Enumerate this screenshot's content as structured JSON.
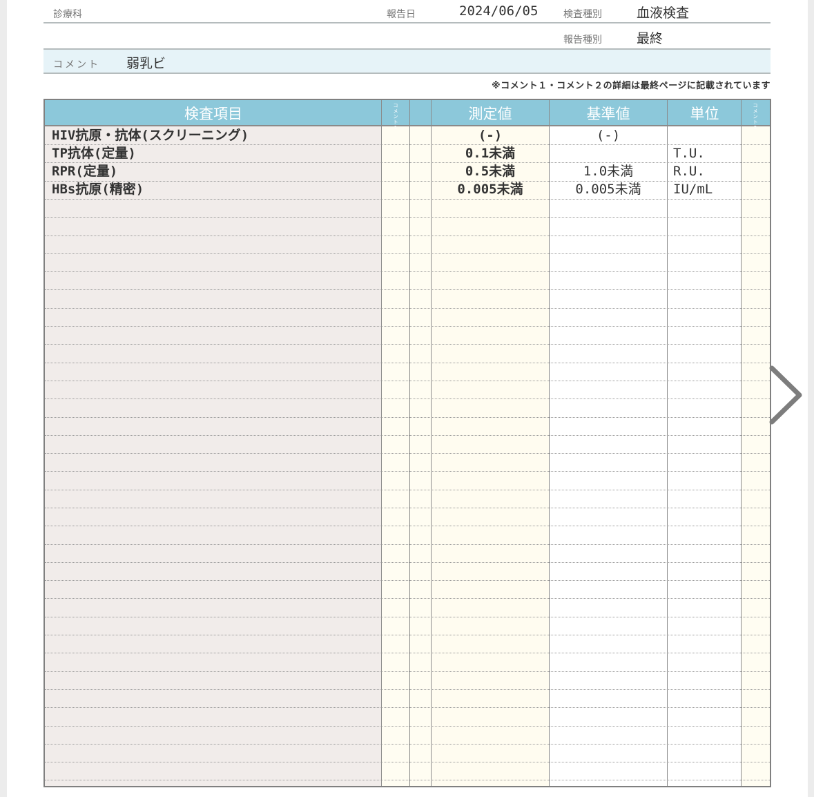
{
  "header": {
    "dept_label": "診療科",
    "report_date_label": "報告日",
    "report_date": "2024/06/05",
    "exam_type_label": "検査種別",
    "exam_type": "血液検査",
    "report_type_label": "報告種別",
    "report_type": "最終"
  },
  "comment": {
    "label": "コメント",
    "text": "弱乳ビ"
  },
  "note": "※コメント１・コメント２の詳細は最終ページに記載されています",
  "table": {
    "headers": {
      "item": "検査項目",
      "comment1": "コメント1",
      "value": "測定値",
      "reference": "基準値",
      "unit": "単位",
      "comment2": "コメント2"
    },
    "rows": [
      {
        "item": "HIV抗原・抗体(スクリーニング)",
        "value": "(-)",
        "reference": "(-)",
        "unit": ""
      },
      {
        "item": "TP抗体(定量)",
        "value": "0.1未満",
        "reference": "",
        "unit": "T.U."
      },
      {
        "item": "RPR(定量)",
        "value": "0.5未満",
        "reference": "1.0未満",
        "unit": "R.U."
      },
      {
        "item": "HBs抗原(精密)",
        "value": "0.005未満",
        "reference": "0.005未満",
        "unit": "IU/mL"
      }
    ]
  },
  "icons": {
    "next_page": "chevron-right-icon"
  }
}
